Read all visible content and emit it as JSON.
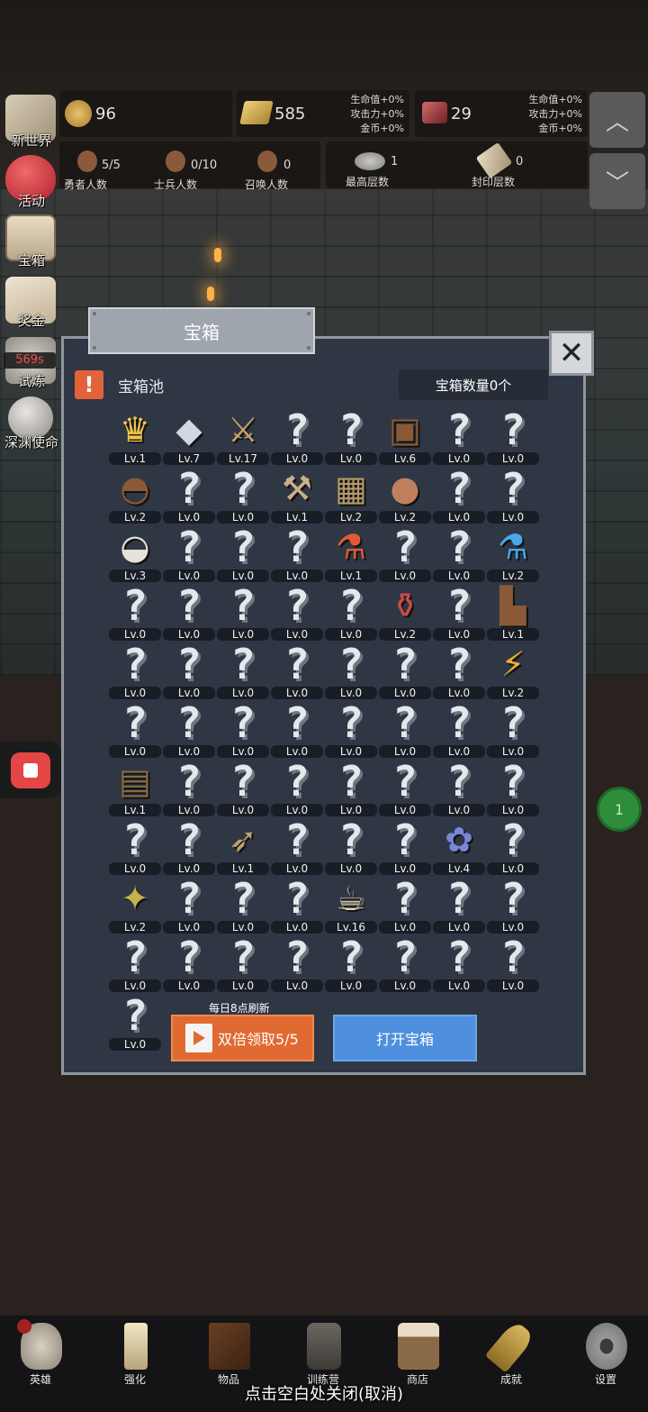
{
  "resources": {
    "gold": "96",
    "bar": "585",
    "bar_bonus": [
      "生命值+0%",
      "攻击力+0%",
      "金币+0%"
    ],
    "gem": "29",
    "gem_bonus": [
      "生命值+0%",
      "攻击力+0%",
      "金币+0%"
    ]
  },
  "counts": [
    {
      "value": "5/5",
      "label": "勇者人数"
    },
    {
      "value": "0/10",
      "label": "士兵人数"
    },
    {
      "value": "0",
      "label": "召唤人数"
    },
    {
      "value": "1",
      "label": "最高层数"
    },
    {
      "value": "0",
      "label": "封印层数"
    }
  ],
  "nav_arrows": {
    "up": "︿",
    "down": "﹀"
  },
  "sidebar": [
    {
      "label": "新世界",
      "icon": "map-icon"
    },
    {
      "label": "活动",
      "icon": "heart-icon"
    },
    {
      "label": "宝箱",
      "icon": "chest-icon"
    },
    {
      "label": "奖金",
      "icon": "envelope-icon"
    },
    {
      "label": "试炼",
      "icon": "trial-icon",
      "badge": "569s"
    },
    {
      "label": "深渊使命",
      "icon": "orb-icon"
    }
  ],
  "modal": {
    "title": "宝箱",
    "close": "✕",
    "warn": "!",
    "pool_title": "宝箱池",
    "chest_count": "宝箱数量0个",
    "refresh_note": "每日8点刷新",
    "double_button": "双倍领取5/5",
    "open_button": "打开宝箱"
  },
  "items": [
    {
      "icon": "crown-icon",
      "lv": "Lv.1"
    },
    {
      "icon": "diamond-icon",
      "lv": "Lv.7"
    },
    {
      "icon": "sword-icon",
      "lv": "Lv.17"
    },
    {
      "icon": "question-icon",
      "lv": "Lv.0"
    },
    {
      "icon": "question-icon",
      "lv": "Lv.0"
    },
    {
      "icon": "armor-icon",
      "lv": "Lv.6"
    },
    {
      "icon": "question-icon",
      "lv": "Lv.0"
    },
    {
      "icon": "question-icon",
      "lv": "Lv.0"
    },
    {
      "icon": "leather-helmet-icon",
      "lv": "Lv.2"
    },
    {
      "icon": "question-icon",
      "lv": "Lv.0"
    },
    {
      "icon": "question-icon",
      "lv": "Lv.0"
    },
    {
      "icon": "hammer-icon",
      "lv": "Lv.1"
    },
    {
      "icon": "knight-helmet-icon",
      "lv": "Lv.2"
    },
    {
      "icon": "ham-icon",
      "lv": "Lv.2"
    },
    {
      "icon": "question-icon",
      "lv": "Lv.0"
    },
    {
      "icon": "question-icon",
      "lv": "Lv.0"
    },
    {
      "icon": "flour-bowl-icon",
      "lv": "Lv.3"
    },
    {
      "icon": "question-icon",
      "lv": "Lv.0"
    },
    {
      "icon": "question-icon",
      "lv": "Lv.0"
    },
    {
      "icon": "question-icon",
      "lv": "Lv.0"
    },
    {
      "icon": "red-potion-icon",
      "lv": "Lv.1"
    },
    {
      "icon": "question-icon",
      "lv": "Lv.0"
    },
    {
      "icon": "question-icon",
      "lv": "Lv.0"
    },
    {
      "icon": "blue-potion-icon",
      "lv": "Lv.2"
    },
    {
      "icon": "question-icon",
      "lv": "Lv.0"
    },
    {
      "icon": "question-icon",
      "lv": "Lv.0"
    },
    {
      "icon": "question-icon",
      "lv": "Lv.0"
    },
    {
      "icon": "question-icon",
      "lv": "Lv.0"
    },
    {
      "icon": "question-icon",
      "lv": "Lv.0"
    },
    {
      "icon": "wine-bottle-icon",
      "lv": "Lv.2"
    },
    {
      "icon": "question-icon",
      "lv": "Lv.0"
    },
    {
      "icon": "boot-icon",
      "lv": "Lv.1"
    },
    {
      "icon": "question-icon",
      "lv": "Lv.0"
    },
    {
      "icon": "question-icon",
      "lv": "Lv.0"
    },
    {
      "icon": "question-icon",
      "lv": "Lv.0"
    },
    {
      "icon": "question-icon",
      "lv": "Lv.0"
    },
    {
      "icon": "question-icon",
      "lv": "Lv.0"
    },
    {
      "icon": "question-icon",
      "lv": "Lv.0"
    },
    {
      "icon": "question-icon",
      "lv": "Lv.0"
    },
    {
      "icon": "torch-icon",
      "lv": "Lv.2"
    },
    {
      "icon": "question-icon",
      "lv": "Lv.0"
    },
    {
      "icon": "question-icon",
      "lv": "Lv.0"
    },
    {
      "icon": "question-icon",
      "lv": "Lv.0"
    },
    {
      "icon": "question-icon",
      "lv": "Lv.0"
    },
    {
      "icon": "question-icon",
      "lv": "Lv.0"
    },
    {
      "icon": "question-icon",
      "lv": "Lv.0"
    },
    {
      "icon": "question-icon",
      "lv": "Lv.0"
    },
    {
      "icon": "question-icon",
      "lv": "Lv.0"
    },
    {
      "icon": "backpack-icon",
      "lv": "Lv.1"
    },
    {
      "icon": "question-icon",
      "lv": "Lv.0"
    },
    {
      "icon": "question-icon",
      "lv": "Lv.0"
    },
    {
      "icon": "question-icon",
      "lv": "Lv.0"
    },
    {
      "icon": "question-icon",
      "lv": "Lv.0"
    },
    {
      "icon": "question-icon",
      "lv": "Lv.0"
    },
    {
      "icon": "question-icon",
      "lv": "Lv.0"
    },
    {
      "icon": "question-icon",
      "lv": "Lv.0"
    },
    {
      "icon": "question-icon",
      "lv": "Lv.0"
    },
    {
      "icon": "question-icon",
      "lv": "Lv.0"
    },
    {
      "icon": "bow-icon",
      "lv": "Lv.1"
    },
    {
      "icon": "question-icon",
      "lv": "Lv.0"
    },
    {
      "icon": "question-icon",
      "lv": "Lv.0"
    },
    {
      "icon": "question-icon",
      "lv": "Lv.0"
    },
    {
      "icon": "tentacle-icon",
      "lv": "Lv.4"
    },
    {
      "icon": "question-icon",
      "lv": "Lv.0"
    },
    {
      "icon": "lantern-staff-icon",
      "lv": "Lv.2"
    },
    {
      "icon": "question-icon",
      "lv": "Lv.0"
    },
    {
      "icon": "question-icon",
      "lv": "Lv.0"
    },
    {
      "icon": "question-icon",
      "lv": "Lv.0"
    },
    {
      "icon": "beer-mug-icon",
      "lv": "Lv.16"
    },
    {
      "icon": "question-icon",
      "lv": "Lv.0"
    },
    {
      "icon": "question-icon",
      "lv": "Lv.0"
    },
    {
      "icon": "question-icon",
      "lv": "Lv.0"
    },
    {
      "icon": "question-icon",
      "lv": "Lv.0"
    },
    {
      "icon": "question-icon",
      "lv": "Lv.0"
    },
    {
      "icon": "question-icon",
      "lv": "Lv.0"
    },
    {
      "icon": "question-icon",
      "lv": "Lv.0"
    },
    {
      "icon": "question-icon",
      "lv": "Lv.0"
    },
    {
      "icon": "question-icon",
      "lv": "Lv.0"
    },
    {
      "icon": "question-icon",
      "lv": "Lv.0"
    },
    {
      "icon": "question-icon",
      "lv": "Lv.0"
    },
    {
      "icon": "question-icon",
      "lv": "Lv.0"
    }
  ],
  "green_button": "1",
  "bottom_tabs": [
    {
      "label": "英雄",
      "icon": "skull-icon"
    },
    {
      "label": "强化",
      "icon": "candle-icon"
    },
    {
      "label": "物品",
      "icon": "book-icon"
    },
    {
      "label": "训练营",
      "icon": "lantern-icon"
    },
    {
      "label": "商店",
      "icon": "shop-mug-icon"
    },
    {
      "label": "成就",
      "icon": "key-icon"
    },
    {
      "label": "设置",
      "icon": "gear-icon"
    }
  ],
  "close_hint": "点击空白处关闭(取消)"
}
